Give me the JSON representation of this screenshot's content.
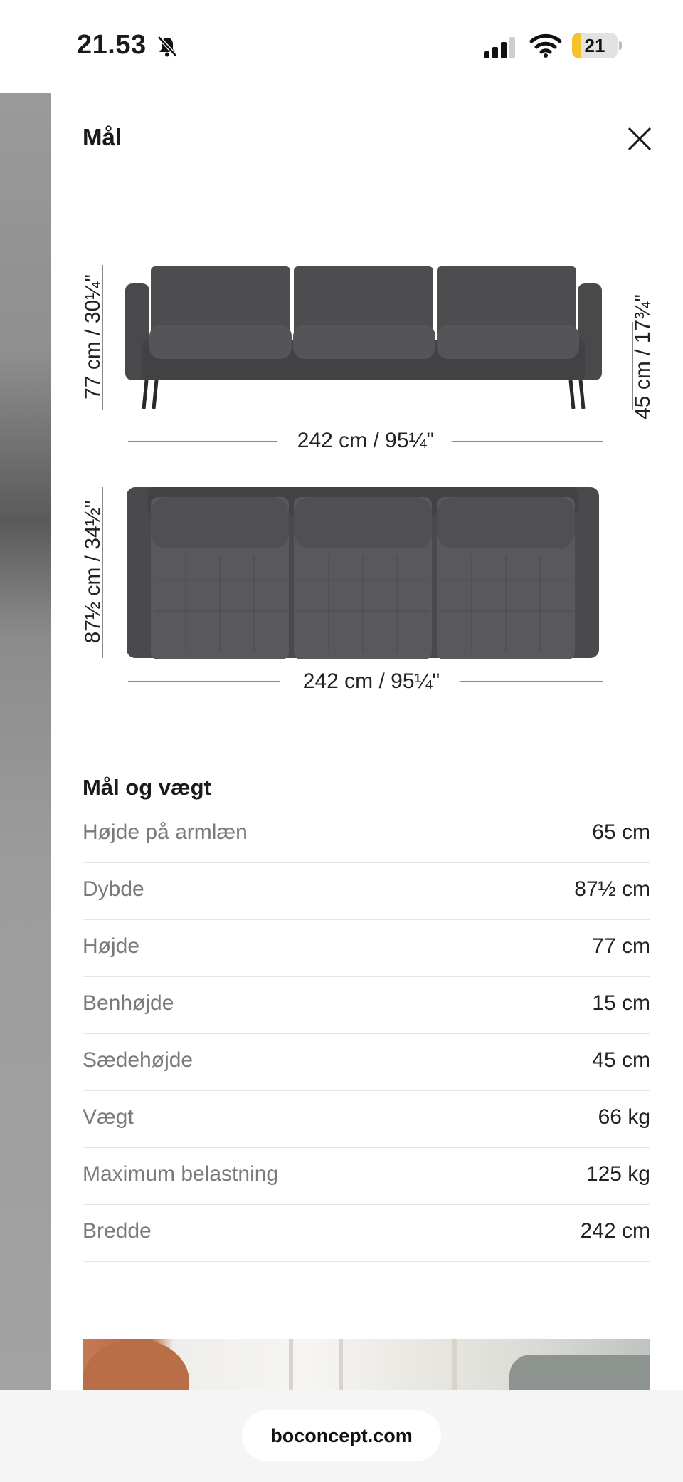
{
  "status_bar": {
    "time": "21.53",
    "battery": "21",
    "battery_fraction": 0.21
  },
  "drawer": {
    "title": "Mål",
    "close_icon": "close-icon"
  },
  "diagram": {
    "front_height": "77 cm / 30¼\"",
    "seat_height": "45 cm / 17¾\"",
    "front_width": "242 cm / 95¼\"",
    "top_depth": "87½ cm / 34½\"",
    "top_width": "242 cm / 95¼\""
  },
  "specs": {
    "title": "Mål og vægt",
    "rows": [
      {
        "label": "Højde på armlæn",
        "value": "65 cm"
      },
      {
        "label": "Dybde",
        "value": "87½ cm"
      },
      {
        "label": "Højde",
        "value": "77 cm"
      },
      {
        "label": "Benhøjde",
        "value": "15 cm"
      },
      {
        "label": "Sædehøjde",
        "value": "45 cm"
      },
      {
        "label": "Vægt",
        "value": "66 kg"
      },
      {
        "label": "Maximum belastning",
        "value": "125 kg"
      },
      {
        "label": "Bredde",
        "value": "242 cm"
      }
    ]
  },
  "browser": {
    "url": "boconcept.com"
  },
  "colors": {
    "battery_accent": "#f4c22b",
    "sofa": "#4a4a4d",
    "divider": "#e6e6e6"
  }
}
